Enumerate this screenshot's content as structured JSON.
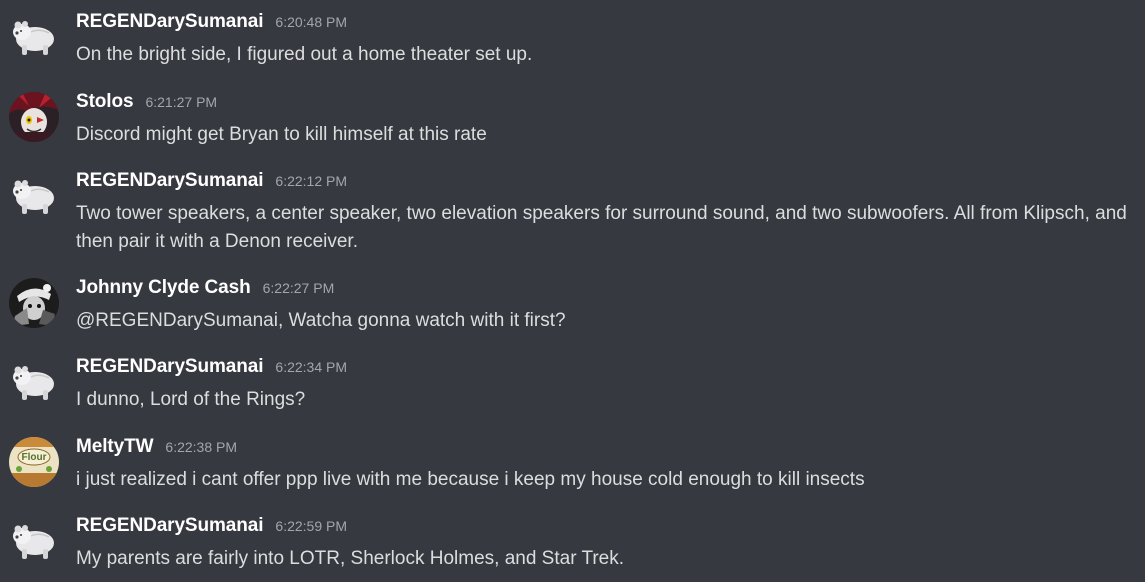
{
  "messages": [
    {
      "author": "REGENDarySumanai",
      "time": "6:20:48 PM",
      "text": "On the bright side, I figured out a home theater set up.",
      "avatar": "polar-bear-avatar"
    },
    {
      "author": "Stolos",
      "time": "6:21:27 PM",
      "text": "Discord might get Bryan to kill himself at this rate",
      "avatar": "character-avatar"
    },
    {
      "author": "REGENDarySumanai",
      "time": "6:22:12 PM",
      "text": "Two tower speakers, a center speaker, two elevation speakers for surround sound, and two subwoofers. All from Klipsch, and then pair it with a Denon receiver.",
      "avatar": "polar-bear-avatar"
    },
    {
      "author": "Johnny Clyde Cash",
      "time": "6:22:27 PM",
      "text": "@REGENDarySumanai, Watcha gonna watch with it first?",
      "avatar": "bw-avatar"
    },
    {
      "author": "REGENDarySumanai",
      "time": "6:22:34 PM",
      "text": "I dunno, Lord of the Rings?",
      "avatar": "polar-bear-avatar"
    },
    {
      "author": "MeltyTW",
      "time": "6:22:38 PM",
      "text": "i just realized i cant offer ppp live with me because i keep my house cold enough to kill insects",
      "avatar": "flour-bag-avatar",
      "avatar_label": "Flour"
    },
    {
      "author": "REGENDarySumanai",
      "time": "6:22:59 PM",
      "text": "My parents are fairly into LOTR, Sherlock Holmes, and Star Trek.",
      "avatar": "polar-bear-avatar"
    }
  ],
  "colors": {
    "background": "#36393f",
    "username": "#ffffff",
    "timestamp": "#a3a6aa",
    "text": "#dcddde"
  }
}
